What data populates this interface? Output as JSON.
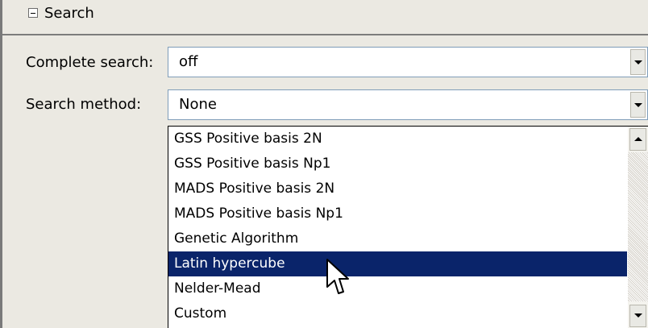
{
  "group": {
    "title": "Search",
    "icon": "minus-box-icon"
  },
  "fields": {
    "complete_search": {
      "label": "Complete search:",
      "value": "off"
    },
    "search_method": {
      "label": "Search method:",
      "value": "None"
    }
  },
  "dropdown": {
    "items": [
      "GSS Positive basis 2N",
      "GSS Positive basis Np1",
      "MADS Positive basis 2N",
      "MADS Positive basis Np1",
      "Genetic Algorithm",
      "Latin hypercube",
      "Nelder-Mead",
      "Custom"
    ],
    "selected_item": "Latin hypercube"
  },
  "colors": {
    "selection_bg": "#0a246a",
    "selection_fg": "#ffffff",
    "panel_bg": "#ebe9e2"
  },
  "cursor": {
    "icon": "arrow-pointer-icon"
  }
}
